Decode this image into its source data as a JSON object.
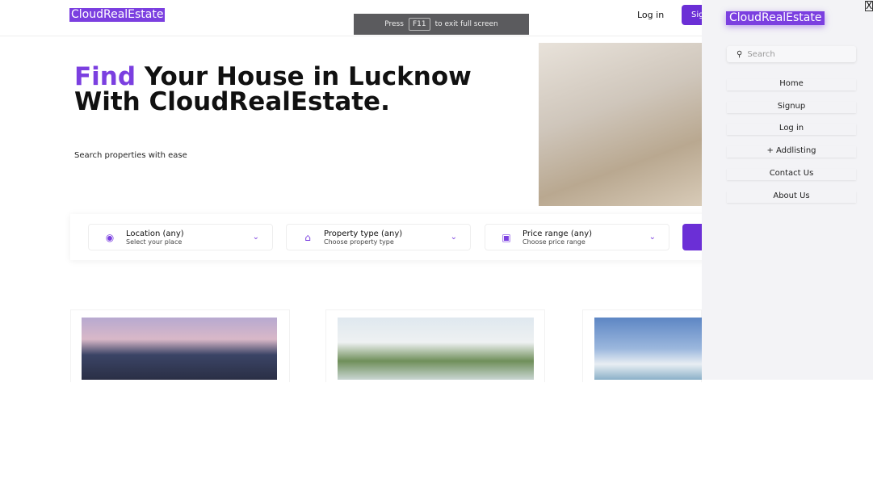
{
  "header": {
    "logo": "CloudRealEstate",
    "login": "Log in",
    "signup": "Sign up"
  },
  "fullscreen_notice": {
    "press": "Press",
    "key": "F11",
    "rest": "to exit full screen"
  },
  "hero": {
    "title_highlight": "Find",
    "title_rest": " Your House in Lucknow With CloudRealEstate.",
    "subtitle": "Search properties with ease"
  },
  "search": {
    "fields": [
      {
        "icon": "location-pin-icon",
        "label": "Location (any)",
        "hint": "Select your place"
      },
      {
        "icon": "house-icon",
        "label": "Property type (any)",
        "hint": "Choose property type"
      },
      {
        "icon": "wallet-icon",
        "label": "Price range (any)",
        "hint": "Choose price range"
      }
    ]
  },
  "sidebar": {
    "logo": "CloudRealEstate",
    "close": "X",
    "search_placeholder": "Search",
    "items": [
      "Home",
      "Signup",
      "Log in",
      "+ Addlisting",
      "Contact Us",
      "About Us"
    ]
  },
  "colors": {
    "accent": "#7b3fe0",
    "button": "#6b2fd6"
  }
}
